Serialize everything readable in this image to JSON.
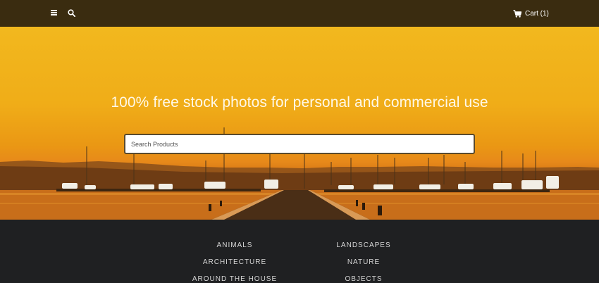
{
  "header": {
    "menu_icon": "hamburger-menu-icon",
    "search_icon": "search-icon",
    "cart_icon": "shopping-cart-icon",
    "cart_label": "Cart (1)"
  },
  "hero": {
    "title": "100% free stock photos for personal and commercial use",
    "search_placeholder": "Search Products"
  },
  "categories": {
    "left": [
      "ANIMALS",
      "ARCHITECTURE",
      "AROUND THE HOUSE"
    ],
    "right": [
      "LANDSCAPES",
      "NATURE",
      "OBJECTS"
    ]
  },
  "colors": {
    "header_bg": "#3a2c10",
    "hero_sky": "#f2b81e",
    "footer_bg": "#1f2022",
    "category_text": "#d6d6d6"
  }
}
